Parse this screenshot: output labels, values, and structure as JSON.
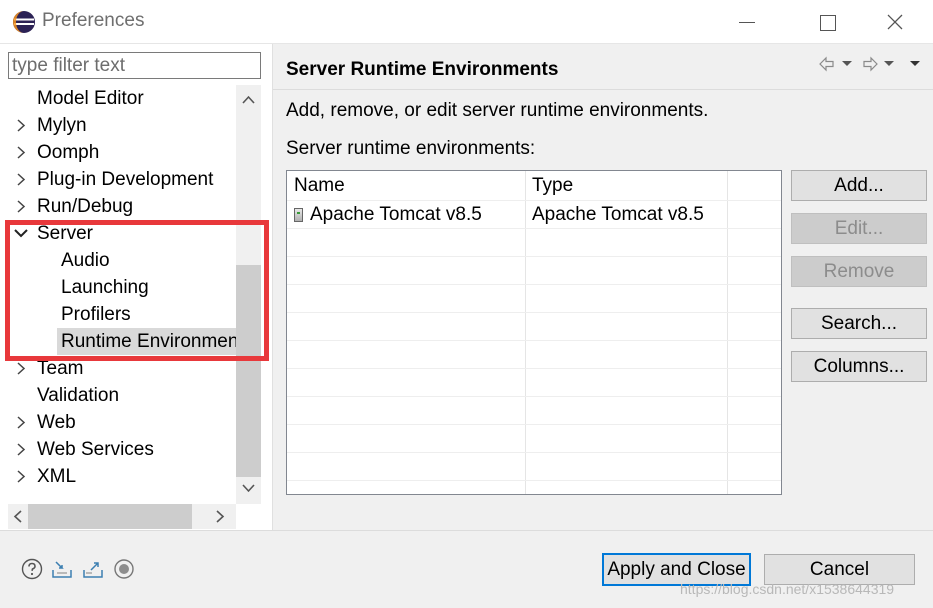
{
  "window": {
    "title": "Preferences",
    "icon": "eclipse-icon"
  },
  "left_pane": {
    "filter_placeholder": "type filter text",
    "tree": [
      {
        "label": "Model Editor",
        "expandable": false
      },
      {
        "label": "Mylyn",
        "expandable": true
      },
      {
        "label": "Oomph",
        "expandable": true
      },
      {
        "label": "Plug-in Development",
        "expandable": true
      },
      {
        "label": "Run/Debug",
        "expandable": true
      },
      {
        "label": "Server",
        "expandable": true,
        "expanded": true
      },
      {
        "label": "Audio",
        "child": true
      },
      {
        "label": "Launching",
        "child": true
      },
      {
        "label": "Profilers",
        "child": true
      },
      {
        "label": "Runtime Environmen",
        "child": true,
        "selected": true
      },
      {
        "label": "Team",
        "expandable": true
      },
      {
        "label": "Validation",
        "expandable": false
      },
      {
        "label": "Web",
        "expandable": true
      },
      {
        "label": "Web Services",
        "expandable": true
      },
      {
        "label": "XML",
        "expandable": true
      }
    ],
    "highlight_color": "#e8383b"
  },
  "right_pane": {
    "title": "Server Runtime Environments",
    "description": "Add, remove, or edit server runtime environments.",
    "list_label": "Server runtime environments:",
    "table": {
      "columns": [
        "Name",
        "Type"
      ],
      "rows": [
        {
          "name": "Apache Tomcat v8.5",
          "type": "Apache Tomcat v8.5"
        }
      ]
    },
    "buttons": {
      "add": "Add...",
      "edit": "Edit...",
      "remove": "Remove",
      "search": "Search...",
      "columns": "Columns..."
    }
  },
  "footer": {
    "apply_close": "Apply and Close",
    "cancel": "Cancel",
    "watermark": "https://blog.csdn.net/x1538644319",
    "accent": "#0078d7"
  }
}
